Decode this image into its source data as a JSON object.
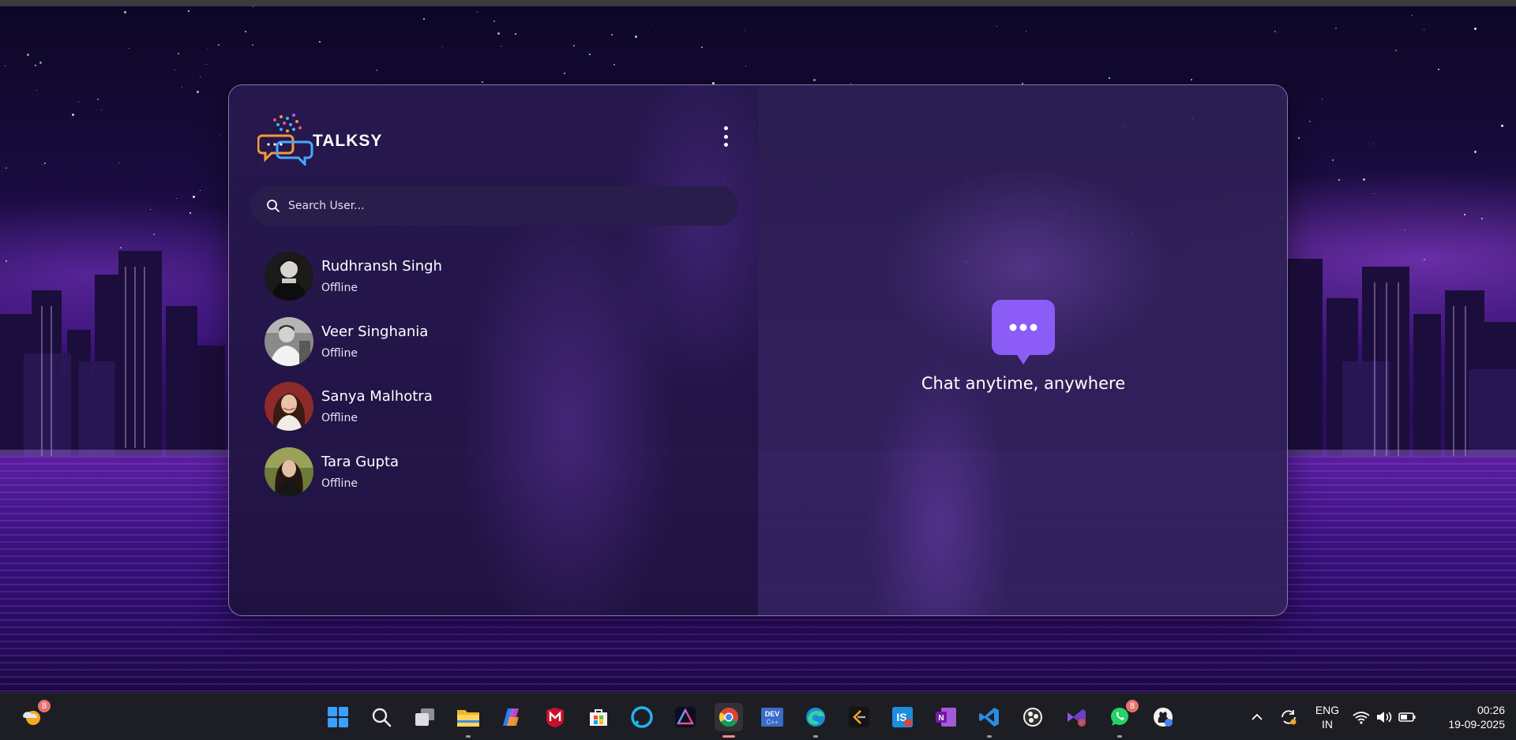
{
  "app": {
    "name": "TALKSY",
    "menu_icon": "kebab-menu-icon",
    "search": {
      "placeholder": "Search User...",
      "value": ""
    },
    "users": [
      {
        "name": "Rudhransh Singh",
        "status": "Offline"
      },
      {
        "name": "Veer Singhania",
        "status": "Offline"
      },
      {
        "name": "Sanya Malhotra",
        "status": "Offline"
      },
      {
        "name": "Tara Gupta",
        "status": "Offline"
      }
    ],
    "empty_state": {
      "icon": "chat-bubble-icon",
      "text": "Chat anytime, anywhere"
    },
    "colors": {
      "accent": "#8b5cf6",
      "panel": "#2a1c52"
    }
  },
  "taskbar": {
    "weather_badge": "8",
    "whatsapp_badge": "8",
    "apps": [
      "windows-start",
      "search",
      "task-view",
      "file-explorer",
      "copilot",
      "mcafee",
      "microsoft-store",
      "alexa",
      "affinity",
      "chrome",
      "devcpp",
      "edge",
      "leetcode",
      "intellij",
      "onenote",
      "vscode",
      "obs",
      "visual-studio",
      "whatsapp",
      "github-desktop"
    ],
    "language": {
      "line1": "ENG",
      "line2": "IN"
    },
    "time": "00:26",
    "date": "19-09-2025"
  }
}
